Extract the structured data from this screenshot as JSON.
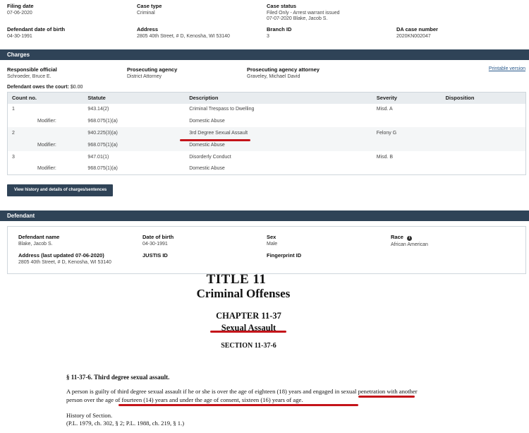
{
  "case": {
    "filing_date_label": "Filing date",
    "filing_date": "07-06-2020",
    "case_type_label": "Case type",
    "case_type": "Criminal",
    "case_status_label": "Case status",
    "case_status_line1": "Filed Only - Arrest warrant issued",
    "case_status_line2": "07-07-2020 Blake, Jacob S.",
    "dob_label": "Defendant date of birth",
    "dob": "04-30-1991",
    "address_label": "Address",
    "address": "2805 40th Street, # D, Kenosha, WI 53140",
    "branch_label": "Branch ID",
    "branch": "3",
    "da_label": "DA case number",
    "da": "2020KN002047"
  },
  "charges": {
    "section_title": "Charges",
    "responsible_label": "Responsible official",
    "responsible": "Schroeder, Bruce E.",
    "agency_label": "Prosecuting agency",
    "agency": "District Attorney",
    "attorney_label": "Prosecuting agency attorney",
    "attorney": "Graveley, Michael David",
    "printable": "Printable version",
    "owes_label": "Defendant owes the court:",
    "owes_value": "$0.00",
    "columns": [
      "Count no.",
      "Statute",
      "Description",
      "Severity",
      "Disposition"
    ],
    "rows": [
      {
        "count": "1",
        "statute": "943.14(2)",
        "description": "Criminal Trespass to Dwelling",
        "severity": "Misd. A",
        "disposition": ""
      },
      {
        "count": "Modifier:",
        "statute": "968.075(1)(a)",
        "description": "Domestic Abuse",
        "severity": "",
        "disposition": ""
      },
      {
        "count": "2",
        "statute": "940.225(3)(a)",
        "description": "3rd Degree Sexual Assault",
        "severity": "Felony G",
        "disposition": ""
      },
      {
        "count": "Modifier:",
        "statute": "968.075(1)(a)",
        "description": "Domestic Abuse",
        "severity": "",
        "disposition": ""
      },
      {
        "count": "3",
        "statute": "947.01(1)",
        "description": "Disorderly Conduct",
        "severity": "Misd. B",
        "disposition": ""
      },
      {
        "count": "Modifier:",
        "statute": "968.075(1)(a)",
        "description": "Domestic Abuse",
        "severity": "",
        "disposition": ""
      }
    ],
    "view_history": "View history and details of charges/sentences"
  },
  "defendant": {
    "section_title": "Defendant",
    "name_label": "Defendant name",
    "name": "Blake, Jacob S.",
    "dob_label": "Date of birth",
    "dob": "04-30-1991",
    "sex_label": "Sex",
    "sex": "Male",
    "race_label": "Race",
    "race": "African American",
    "address_label": "Address (last updated 07-06-2020)",
    "address": "2805 40th Street, # D, Kenosha, WI 53140",
    "justis_label": "JUSTIS ID",
    "fingerprint_label": "Fingerprint ID"
  },
  "statute_doc": {
    "title": "TITLE 11",
    "subtitle": "Criminal Offenses",
    "chapter": "CHAPTER 11-37",
    "chapter_name": "Sexual Assault",
    "section": "SECTION 11-37-6",
    "heading": "§ 11-37-6. Third degree sexual assault.",
    "body": "A person is guilty of third degree sexual assault if he or she is over the age of eighteen (18) years and engaged in sexual penetration with another person over the age of fourteen (14) years and under the age of consent, sixteen (16) years of age.",
    "history_label": "History of Section.",
    "history": "(P.L. 1979, ch. 302, § 2; P.L. 1988, ch. 219, § 1.)"
  },
  "colors": {
    "header_bar": "#2f4357",
    "highlight": "#c4141a",
    "link": "#2a5a8c"
  }
}
